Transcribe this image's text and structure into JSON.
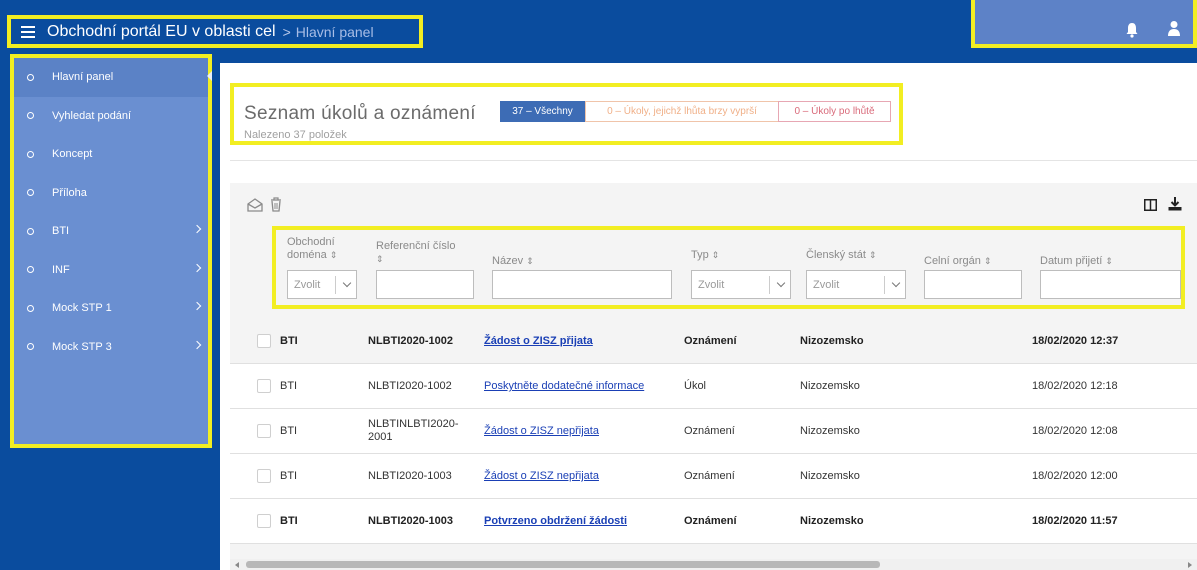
{
  "header": {
    "app_title": "Obchodní portál EU v oblasti cel",
    "breadcrumb_sep": ">",
    "breadcrumb_current": "Hlavní panel"
  },
  "sidebar": {
    "items": [
      {
        "label": "Hlavní panel",
        "active": true,
        "has_submenu": false
      },
      {
        "label": "Vyhledat podání",
        "has_submenu": false
      },
      {
        "label": "Koncept",
        "has_submenu": false
      },
      {
        "label": "Příloha",
        "has_submenu": false
      },
      {
        "label": "BTI",
        "has_submenu": true
      },
      {
        "label": "INF",
        "has_submenu": true
      },
      {
        "label": "Mock STP 1",
        "has_submenu": true
      },
      {
        "label": "Mock STP 3",
        "has_submenu": true
      }
    ]
  },
  "main": {
    "title": "Seznam úkolů a oznámení",
    "found_text": "Nalezeno 37 položek",
    "filters": {
      "all": "37 – Všechny",
      "soon": "0 – Úkoly, jejichž lhůta brzy vyprší",
      "late": "0 – Úkoly po lhůtě"
    }
  },
  "table": {
    "columns": {
      "domain_l1": "Obchodní",
      "domain_l2": "doména",
      "ref_l1": "Referenční číslo",
      "name": "Název",
      "type": "Typ",
      "state": "Členský stát",
      "office": "Celní orgán",
      "date": "Datum přijetí"
    },
    "sort_glyph": "⇕",
    "select_placeholder": "Zvolit",
    "rows": [
      {
        "domain": "BTI",
        "ref": "NLBTI2020-1002",
        "name": "Žádost o ZISZ přijata",
        "type": "Oznámení",
        "state": "Nizozemsko",
        "date": "18/02/2020 12:37",
        "bold": true
      },
      {
        "domain": "BTI",
        "ref": "NLBTI2020-1002",
        "name": "Poskytněte dodatečné informace",
        "type": "Úkol",
        "state": "Nizozemsko",
        "date": "18/02/2020 12:18",
        "bold": false
      },
      {
        "domain": "BTI",
        "ref": "NLBTINLBTI2020-2001",
        "name": "Žádost o ZISZ nepřijata",
        "type": "Oznámení",
        "state": "Nizozemsko",
        "date": "18/02/2020 12:08",
        "bold": false
      },
      {
        "domain": "BTI",
        "ref": "NLBTI2020-1003",
        "name": "Žádost o ZISZ nepřijata",
        "type": "Oznámení",
        "state": "Nizozemsko",
        "date": "18/02/2020 12:00",
        "bold": false
      },
      {
        "domain": "BTI",
        "ref": "NLBTI2020-1003",
        "name": "Potvrzeno obdržení žádosti",
        "type": "Oznámení",
        "state": "Nizozemsko",
        "date": "18/02/2020 11:57",
        "bold": true
      }
    ]
  },
  "colors": {
    "brand_blue": "#0a4c9e",
    "sidebar_blue": "#6a8fd1",
    "highlight_yellow": "#f2ee22",
    "link_blue": "#1a3fb5"
  },
  "icons": {
    "menu": "hamburger-icon",
    "notifications": "bell-icon",
    "user": "user-icon",
    "mark_read": "envelope-open-icon",
    "delete": "trash-icon",
    "columns": "columns-icon",
    "download": "download-icon"
  }
}
